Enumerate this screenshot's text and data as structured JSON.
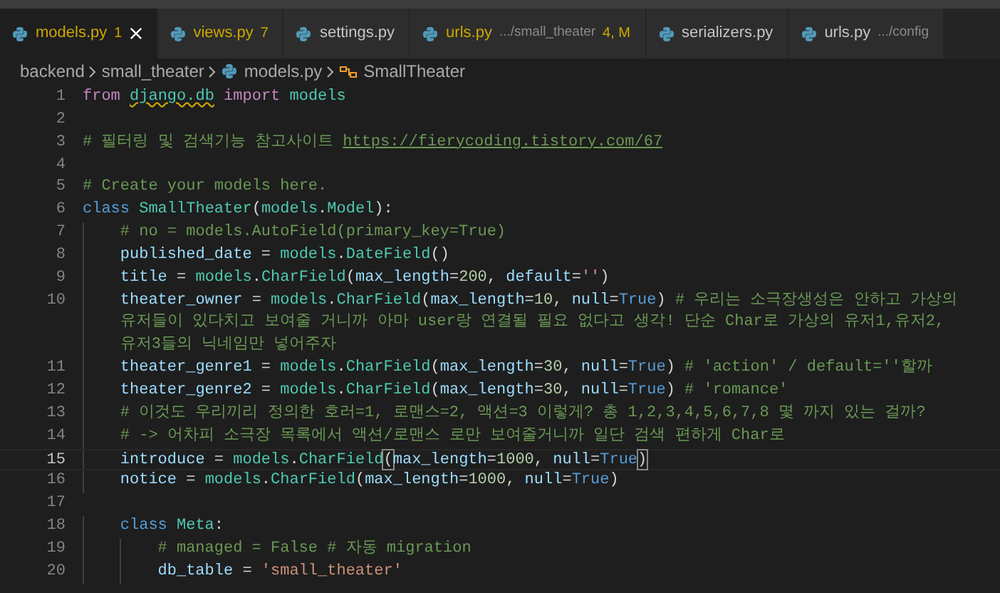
{
  "tabs": [
    {
      "label": "models.py",
      "badge": "1",
      "selected": true,
      "problems": true
    },
    {
      "label": "views.py",
      "badge": "7",
      "selected": false,
      "problems": true
    },
    {
      "label": "settings.py",
      "selected": false,
      "problems": false
    },
    {
      "label": "urls.py",
      "path": ".../small_theater",
      "badge": "4, M",
      "selected": false,
      "problems": true
    },
    {
      "label": "serializers.py",
      "selected": false,
      "problems": false
    },
    {
      "label": "urls.py",
      "path": ".../config",
      "selected": false,
      "problems": false
    }
  ],
  "breadcrumb": [
    {
      "kind": "folder",
      "label": "backend"
    },
    {
      "kind": "folder",
      "label": "small_theater"
    },
    {
      "kind": "file",
      "label": "models.py"
    },
    {
      "kind": "class",
      "label": "SmallTheater"
    }
  ],
  "code": [
    {
      "number": "1",
      "current": false,
      "rows": [
        [
          {
            "kind": "kw",
            "t": "from "
          },
          {
            "kind": "mod",
            "t": "django.db",
            "warning": true
          },
          {
            "kind": "kw",
            "t": " import "
          },
          {
            "kind": "mod",
            "t": "models"
          }
        ]
      ]
    },
    {
      "number": "2",
      "current": false,
      "rows": [
        []
      ]
    },
    {
      "number": "3",
      "current": false,
      "rows": [
        [
          {
            "kind": "comment",
            "t": "# 필터링 및 검색기능 참고사이트 "
          },
          {
            "kind": "link",
            "t": "https://fierycoding.tistory.com/67"
          }
        ]
      ]
    },
    {
      "number": "4",
      "current": false,
      "rows": [
        []
      ]
    },
    {
      "number": "5",
      "current": false,
      "rows": [
        [
          {
            "kind": "comment",
            "t": "# Create your models here."
          }
        ]
      ]
    },
    {
      "number": "6",
      "current": false,
      "rows": [
        [
          {
            "kind": "keyword",
            "t": "class "
          },
          {
            "kind": "mod",
            "t": "SmallTheater"
          },
          {
            "kind": "plain",
            "t": "("
          },
          {
            "kind": "mod",
            "t": "models"
          },
          {
            "kind": "plain",
            "t": "."
          },
          {
            "kind": "mod",
            "t": "Model"
          },
          {
            "kind": "plain",
            "t": "):"
          }
        ]
      ]
    },
    {
      "number": "7",
      "current": false,
      "rows": [
        [
          {
            "kind": "comment",
            "t": "    # no = models.AutoField(primary_key=True)"
          }
        ]
      ]
    },
    {
      "number": "8",
      "current": false,
      "rows": [
        [
          {
            "kind": "var",
            "t": "    published_date"
          },
          {
            "kind": "plain",
            "t": " = "
          },
          {
            "kind": "mod",
            "t": "models"
          },
          {
            "kind": "plain",
            "t": "."
          },
          {
            "kind": "mod",
            "t": "DateField"
          },
          {
            "kind": "plain",
            "t": "()"
          }
        ]
      ]
    },
    {
      "number": "9",
      "current": false,
      "rows": [
        [
          {
            "kind": "var",
            "t": "    title"
          },
          {
            "kind": "plain",
            "t": " = "
          },
          {
            "kind": "mod",
            "t": "models"
          },
          {
            "kind": "plain",
            "t": "."
          },
          {
            "kind": "mod",
            "t": "CharField"
          },
          {
            "kind": "plain",
            "t": "("
          },
          {
            "kind": "var",
            "t": "max_length"
          },
          {
            "kind": "plain",
            "t": "="
          },
          {
            "kind": "num",
            "t": "200"
          },
          {
            "kind": "plain",
            "t": ", "
          },
          {
            "kind": "var",
            "t": "default"
          },
          {
            "kind": "plain",
            "t": "="
          },
          {
            "kind": "str",
            "t": "''"
          },
          {
            "kind": "plain",
            "t": ")"
          }
        ]
      ]
    },
    {
      "number": "10",
      "current": false,
      "rows": [
        [
          {
            "kind": "var",
            "t": "    theater_owner"
          },
          {
            "kind": "plain",
            "t": " = "
          },
          {
            "kind": "mod",
            "t": "models"
          },
          {
            "kind": "plain",
            "t": "."
          },
          {
            "kind": "mod",
            "t": "CharField"
          },
          {
            "kind": "plain",
            "t": "("
          },
          {
            "kind": "var",
            "t": "max_length"
          },
          {
            "kind": "plain",
            "t": "="
          },
          {
            "kind": "num",
            "t": "10"
          },
          {
            "kind": "plain",
            "t": ", "
          },
          {
            "kind": "var",
            "t": "null"
          },
          {
            "kind": "plain",
            "t": "="
          },
          {
            "kind": "keyword",
            "t": "True"
          },
          {
            "kind": "plain",
            "t": ") "
          },
          {
            "kind": "comment",
            "t": "# 우리는 소극장생성은 안하고 가상의"
          }
        ],
        [
          {
            "kind": "comment",
            "t": "    유저들이 있다치고 보여줄 거니까 아마 user랑 연결될 필요 없다고 생각! 단순 Char로 가상의 유저1,유저2,"
          }
        ],
        [
          {
            "kind": "comment",
            "t": "    유저3들의 닉네임만 넣어주자"
          }
        ]
      ]
    },
    {
      "number": "11",
      "current": false,
      "rows": [
        [
          {
            "kind": "var",
            "t": "    theater_genre1"
          },
          {
            "kind": "plain",
            "t": " = "
          },
          {
            "kind": "mod",
            "t": "models"
          },
          {
            "kind": "plain",
            "t": "."
          },
          {
            "kind": "mod",
            "t": "CharField"
          },
          {
            "kind": "plain",
            "t": "("
          },
          {
            "kind": "var",
            "t": "max_length"
          },
          {
            "kind": "plain",
            "t": "="
          },
          {
            "kind": "num",
            "t": "30"
          },
          {
            "kind": "plain",
            "t": ", "
          },
          {
            "kind": "var",
            "t": "null"
          },
          {
            "kind": "plain",
            "t": "="
          },
          {
            "kind": "keyword",
            "t": "True"
          },
          {
            "kind": "plain",
            "t": ") "
          },
          {
            "kind": "comment",
            "t": "# 'action' / default=''할까"
          }
        ]
      ]
    },
    {
      "number": "12",
      "current": false,
      "rows": [
        [
          {
            "kind": "var",
            "t": "    theater_genre2"
          },
          {
            "kind": "plain",
            "t": " = "
          },
          {
            "kind": "mod",
            "t": "models"
          },
          {
            "kind": "plain",
            "t": "."
          },
          {
            "kind": "mod",
            "t": "CharField"
          },
          {
            "kind": "plain",
            "t": "("
          },
          {
            "kind": "var",
            "t": "max_length"
          },
          {
            "kind": "plain",
            "t": "="
          },
          {
            "kind": "num",
            "t": "30"
          },
          {
            "kind": "plain",
            "t": ", "
          },
          {
            "kind": "var",
            "t": "null"
          },
          {
            "kind": "plain",
            "t": "="
          },
          {
            "kind": "keyword",
            "t": "True"
          },
          {
            "kind": "plain",
            "t": ") "
          },
          {
            "kind": "comment",
            "t": "# 'romance'"
          }
        ]
      ]
    },
    {
      "number": "13",
      "current": false,
      "rows": [
        [
          {
            "kind": "comment",
            "t": "    # 이것도 우리끼리 정의한 호러=1, 로맨스=2, 액션=3 이렇게? 총 1,2,3,4,5,6,7,8 몇 까지 있는 걸까?"
          }
        ]
      ]
    },
    {
      "number": "14",
      "current": false,
      "rows": [
        [
          {
            "kind": "comment",
            "t": "    # -> 어차피 소극장 목록에서 액션/로맨스 로만 보여줄거니까 일단 검색 편하게 Char로"
          }
        ]
      ]
    },
    {
      "number": "15",
      "current": true,
      "rows": [
        [
          {
            "kind": "var",
            "t": "    introduce"
          },
          {
            "kind": "plain",
            "t": " = "
          },
          {
            "kind": "mod",
            "t": "models"
          },
          {
            "kind": "plain",
            "t": "."
          },
          {
            "kind": "mod",
            "t": "CharField"
          },
          {
            "kind": "bracket",
            "t": "("
          },
          {
            "kind": "var",
            "t": "max_length"
          },
          {
            "kind": "plain",
            "t": "="
          },
          {
            "kind": "num",
            "t": "1000"
          },
          {
            "kind": "plain",
            "t": ", "
          },
          {
            "kind": "var",
            "t": "null"
          },
          {
            "kind": "plain",
            "t": "="
          },
          {
            "kind": "keyword",
            "t": "True"
          },
          {
            "kind": "bracket",
            "t": ")"
          }
        ]
      ]
    },
    {
      "number": "16",
      "current": false,
      "rows": [
        [
          {
            "kind": "var",
            "t": "    notice"
          },
          {
            "kind": "plain",
            "t": " = "
          },
          {
            "kind": "mod",
            "t": "models"
          },
          {
            "kind": "plain",
            "t": "."
          },
          {
            "kind": "mod",
            "t": "CharField"
          },
          {
            "kind": "plain",
            "t": "("
          },
          {
            "kind": "var",
            "t": "max_length"
          },
          {
            "kind": "plain",
            "t": "="
          },
          {
            "kind": "num",
            "t": "1000"
          },
          {
            "kind": "plain",
            "t": ", "
          },
          {
            "kind": "var",
            "t": "null"
          },
          {
            "kind": "plain",
            "t": "="
          },
          {
            "kind": "keyword",
            "t": "True"
          },
          {
            "kind": "plain",
            "t": ")"
          }
        ]
      ]
    },
    {
      "number": "17",
      "current": false,
      "rows": [
        []
      ]
    },
    {
      "number": "18",
      "current": false,
      "rows": [
        [
          {
            "kind": "keyword",
            "t": "    class "
          },
          {
            "kind": "mod",
            "t": "Meta"
          },
          {
            "kind": "plain",
            "t": ":"
          }
        ]
      ]
    },
    {
      "number": "19",
      "current": false,
      "rows": [
        [
          {
            "kind": "comment",
            "t": "        # managed = False # 자동 migration"
          }
        ]
      ]
    },
    {
      "number": "20",
      "current": false,
      "rows": [
        [
          {
            "kind": "var",
            "t": "        db_table"
          },
          {
            "kind": "plain",
            "t": " = "
          },
          {
            "kind": "str",
            "t": "'small_theater'"
          }
        ]
      ]
    }
  ]
}
